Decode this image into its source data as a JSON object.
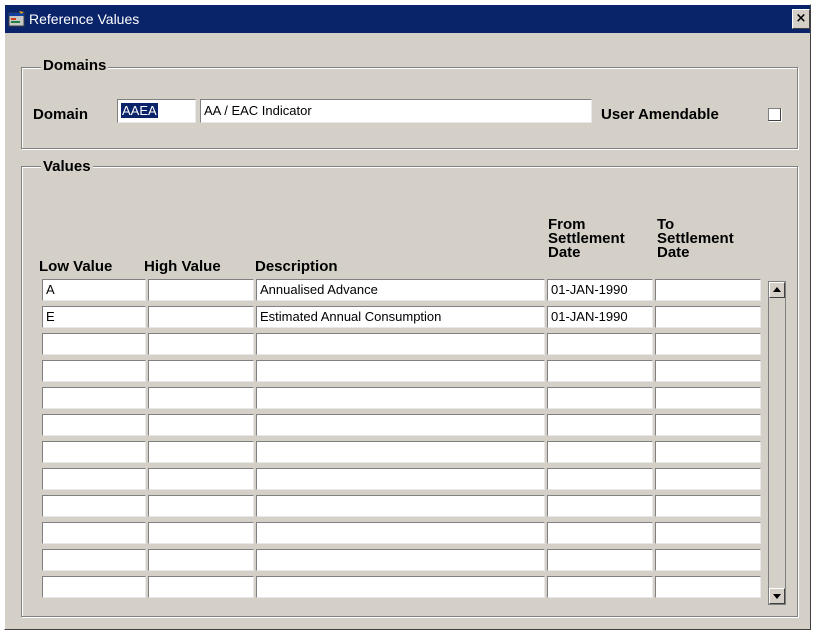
{
  "window": {
    "title": "Reference Values",
    "close_label": "×"
  },
  "domains": {
    "legend": "Domains",
    "domain_label": "Domain",
    "domain_code": "AAEA",
    "domain_description": "AA / EAC Indicator",
    "user_amendable_label": "User Amendable",
    "user_amendable_checked": false
  },
  "values": {
    "legend": "Values",
    "columns": {
      "low": "Low Value",
      "high": "High Value",
      "description": "Description",
      "from_l1": "From",
      "from_l2": "Settlement",
      "from_l3": "Date",
      "to_l1": "To",
      "to_l2": "Settlement",
      "to_l3": "Date"
    },
    "rows": [
      {
        "low": "A",
        "high": "",
        "description": "Annualised Advance",
        "from": "01-JAN-1990",
        "to": ""
      },
      {
        "low": "E",
        "high": "",
        "description": "Estimated Annual Consumption",
        "from": "01-JAN-1990",
        "to": ""
      },
      {
        "low": "",
        "high": "",
        "description": "",
        "from": "",
        "to": ""
      },
      {
        "low": "",
        "high": "",
        "description": "",
        "from": "",
        "to": ""
      },
      {
        "low": "",
        "high": "",
        "description": "",
        "from": "",
        "to": ""
      },
      {
        "low": "",
        "high": "",
        "description": "",
        "from": "",
        "to": ""
      },
      {
        "low": "",
        "high": "",
        "description": "",
        "from": "",
        "to": ""
      },
      {
        "low": "",
        "high": "",
        "description": "",
        "from": "",
        "to": ""
      },
      {
        "low": "",
        "high": "",
        "description": "",
        "from": "",
        "to": ""
      },
      {
        "low": "",
        "high": "",
        "description": "",
        "from": "",
        "to": ""
      },
      {
        "low": "",
        "high": "",
        "description": "",
        "from": "",
        "to": ""
      },
      {
        "low": "",
        "high": "",
        "description": "",
        "from": "",
        "to": ""
      }
    ]
  },
  "icons": {
    "title": "app-window-icon",
    "scroll_up": "scroll-up-arrow-icon",
    "scroll_down": "scroll-down-arrow-icon"
  },
  "colors": {
    "titlebar": "#0a246a",
    "face": "#d4d0c8",
    "selection": "#0a246a"
  }
}
